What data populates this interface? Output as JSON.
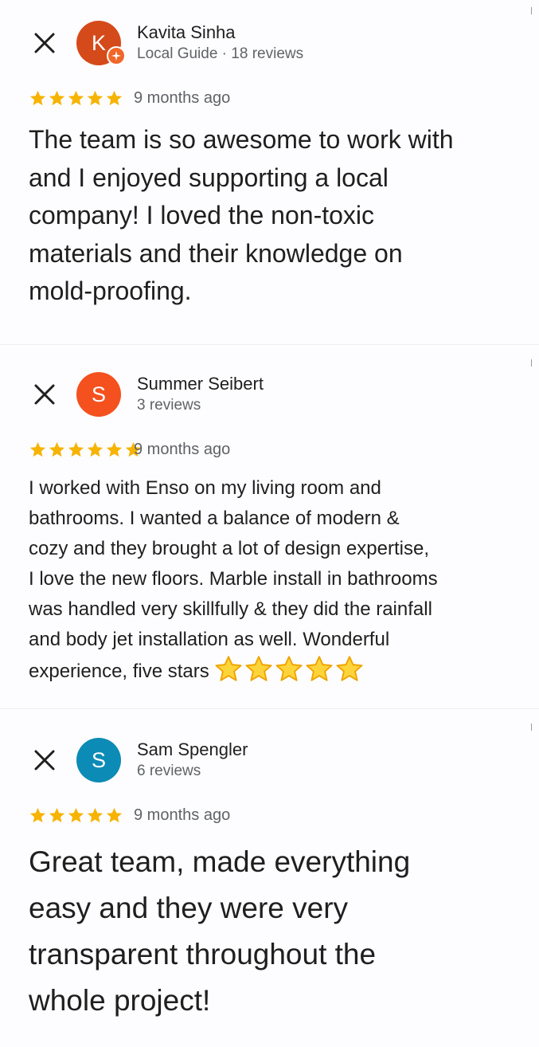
{
  "reviews": [
    {
      "author": "Kavita Sinha",
      "meta": "Local Guide · 18 reviews",
      "initial": "K",
      "avatar_color": "#d54a1a",
      "local_guide_badge": true,
      "rating": 5,
      "time_ago": "9 months ago",
      "text": "The team is so awesome to work with\nand I enjoyed supporting a local\ncompany! I loved the non-toxic\nmaterials and their knowledge on\nmold-proofing."
    },
    {
      "author": "Summer Seibert",
      "meta": "3 reviews",
      "initial": "S",
      "avatar_color": "#f4511e",
      "local_guide_badge": false,
      "rating": 5,
      "time_ago": "9 months ago",
      "text": "I worked with Enso on my living room and\nbathrooms. I wanted a balance of modern &\ncozy and they brought a lot of design expertise,\nI love the new floors. Marble install in bathrooms\nwas handled very skillfully & they did the rainfall\nand body jet installation as well. Wonderful\nexperience, five stars",
      "trailing_emoji": "⭐⭐⭐⭐⭐"
    },
    {
      "author": "Sam Spengler",
      "meta": "6 reviews",
      "initial": "S",
      "avatar_color": "#0b8bb5",
      "local_guide_badge": false,
      "rating": 5,
      "time_ago": "9 months ago",
      "text": "Great team, made everything\neasy and they were very\ntransparent throughout the\nwhole project!"
    }
  ],
  "colors": {
    "star": "#f6b400",
    "text": "#1f1f1f",
    "secondary_text": "#5f6368",
    "background": "#fdfcfe"
  },
  "icons": {
    "close": "close-icon",
    "star": "star-icon",
    "badge": "local-guide-badge-icon"
  }
}
